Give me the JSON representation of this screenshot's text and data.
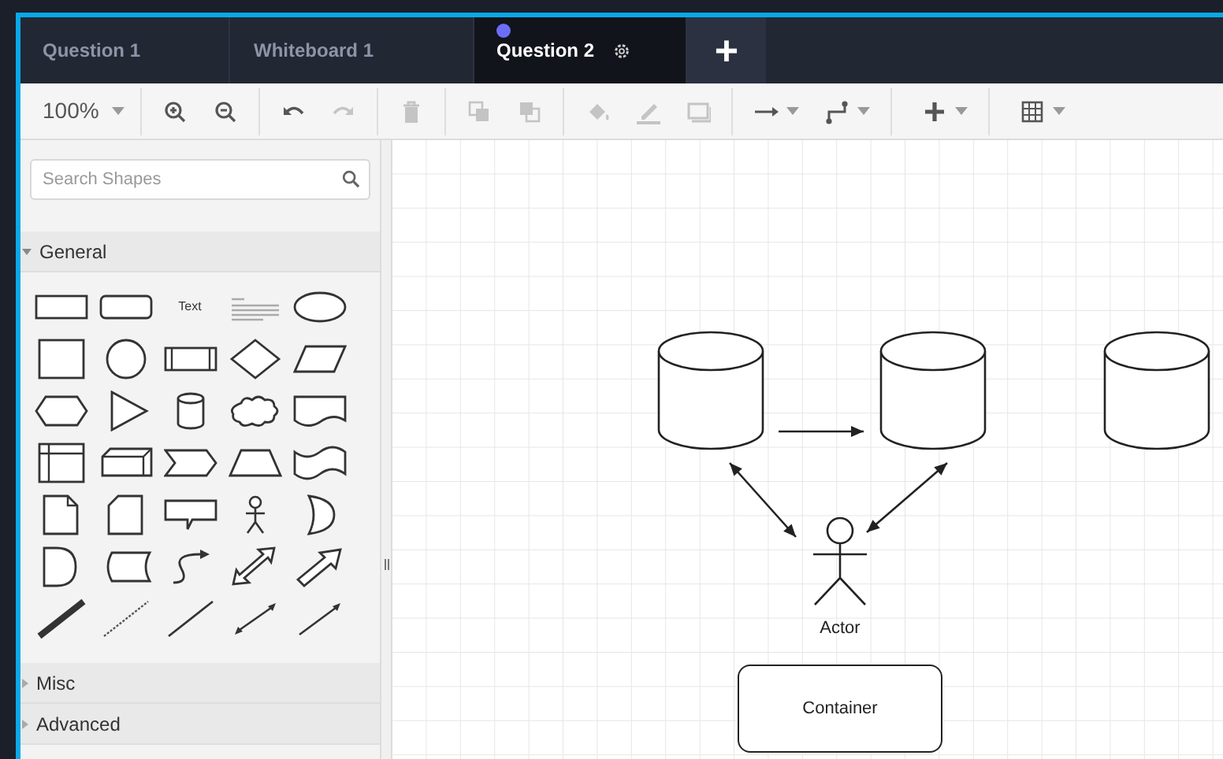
{
  "tabs": [
    {
      "label": "Question 1",
      "selected": false,
      "dot": false,
      "gear": false
    },
    {
      "label": "Whiteboard 1",
      "selected": false,
      "dot": false,
      "gear": false
    },
    {
      "label": "Question 2",
      "selected": true,
      "dot": true,
      "gear": true
    }
  ],
  "new_tab_button": {
    "label": "+"
  },
  "toolbar": {
    "groups": [
      [
        {
          "kind": "zoom_select",
          "label": "100%",
          "disabled": false
        }
      ],
      [
        {
          "kind": "zoom_in",
          "disabled": false
        },
        {
          "kind": "zoom_out",
          "disabled": false
        }
      ],
      [
        {
          "kind": "undo",
          "disabled": false
        },
        {
          "kind": "redo",
          "disabled": true
        }
      ],
      [
        {
          "kind": "delete",
          "disabled": true
        }
      ],
      [
        {
          "kind": "to_front",
          "disabled": true
        },
        {
          "kind": "to_back",
          "disabled": true
        }
      ],
      [
        {
          "kind": "fill",
          "disabled": true
        },
        {
          "kind": "line_color",
          "disabled": true
        },
        {
          "kind": "shadow",
          "disabled": true
        }
      ],
      [
        {
          "kind": "connection",
          "disabled": false
        },
        {
          "kind": "waypoints",
          "disabled": false
        }
      ],
      [
        {
          "kind": "insert",
          "disabled": false
        }
      ],
      [
        {
          "kind": "table",
          "disabled": false
        }
      ]
    ]
  },
  "sidebar": {
    "search": {
      "placeholder": "Search Shapes"
    },
    "sections": [
      {
        "label": "General",
        "expanded": true,
        "shapes": [
          {
            "kind": "rectangle"
          },
          {
            "kind": "rounded"
          },
          {
            "kind": "text",
            "label": "Text"
          },
          {
            "kind": "textbox"
          },
          {
            "kind": "ellipse"
          },
          {
            "kind": "square"
          },
          {
            "kind": "circle"
          },
          {
            "kind": "process"
          },
          {
            "kind": "diamond"
          },
          {
            "kind": "parallelogram"
          },
          {
            "kind": "hexagon"
          },
          {
            "kind": "triangle"
          },
          {
            "kind": "cylinder"
          },
          {
            "kind": "cloud"
          },
          {
            "kind": "document"
          },
          {
            "kind": "internal_storage"
          },
          {
            "kind": "cube"
          },
          {
            "kind": "step"
          },
          {
            "kind": "trapezoid"
          },
          {
            "kind": "tape"
          },
          {
            "kind": "note"
          },
          {
            "kind": "card"
          },
          {
            "kind": "callout"
          },
          {
            "kind": "actor"
          },
          {
            "kind": "or"
          },
          {
            "kind": "delay"
          },
          {
            "kind": "stored_data"
          },
          {
            "kind": "curve"
          },
          {
            "kind": "double_block_arrow"
          },
          {
            "kind": "block_arrow"
          },
          {
            "kind": "thick_line"
          },
          {
            "kind": "dashed_line"
          },
          {
            "kind": "line"
          },
          {
            "kind": "bidirectional"
          },
          {
            "kind": "directional"
          }
        ]
      },
      {
        "label": "Misc",
        "expanded": false
      },
      {
        "label": "Advanced",
        "expanded": false
      }
    ]
  },
  "canvas": {
    "shapes": [
      {
        "kind": "cylinder"
      },
      {
        "kind": "cylinder"
      },
      {
        "kind": "cylinder"
      },
      {
        "kind": "actor",
        "label": "Actor"
      },
      {
        "kind": "container",
        "label": "Container"
      }
    ],
    "connectors": [
      {
        "kind": "arrow"
      },
      {
        "kind": "double_arrow"
      },
      {
        "kind": "double_arrow"
      }
    ]
  }
}
